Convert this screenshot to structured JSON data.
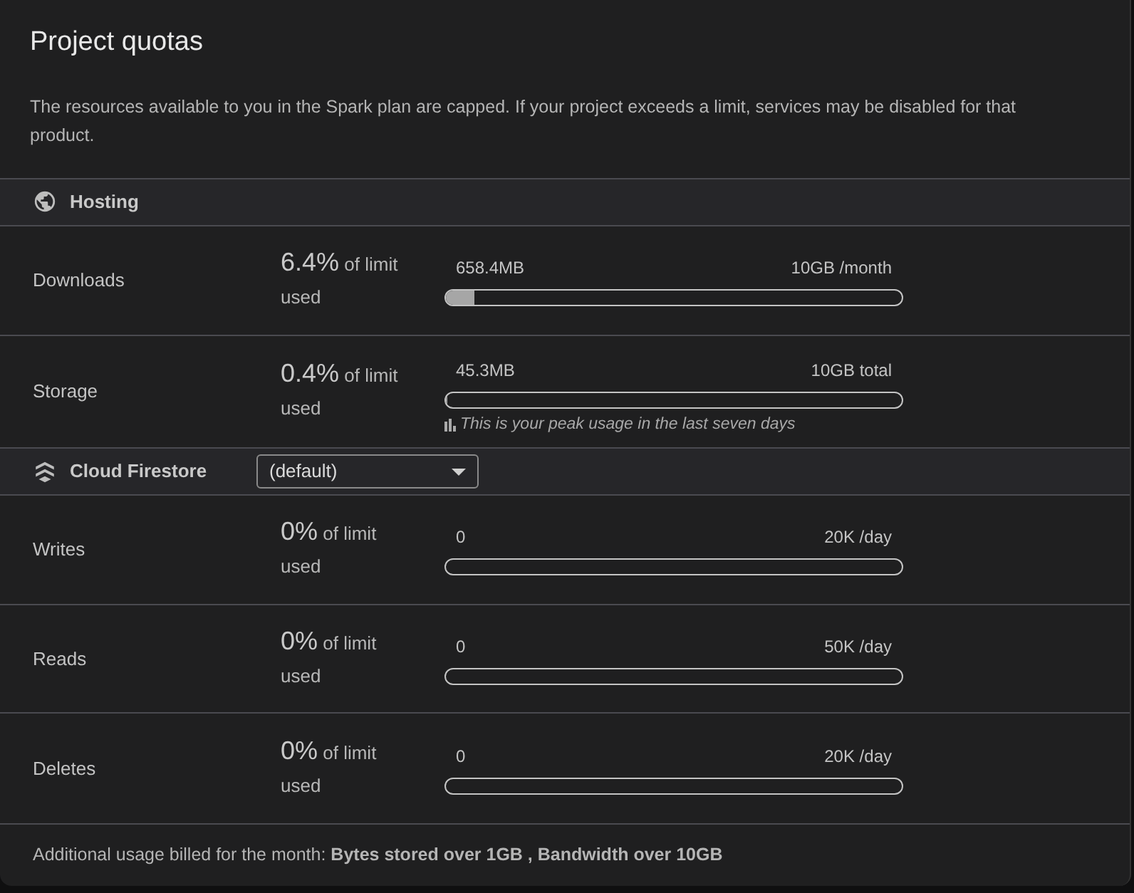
{
  "title": "Project quotas",
  "description": "The resources available to you in the Spark plan are capped. If your project exceeds a limit, services may be disabled for that product.",
  "sections": [
    {
      "title": "Hosting",
      "kind": "hosting",
      "rows": [
        {
          "label": "Downloads",
          "percent": "6.4%",
          "caption": "of limit used",
          "used": "658.4MB",
          "limit": "10GB /month",
          "level": 0.064
        },
        {
          "label": "Storage",
          "percent": "0.4%",
          "caption": "of limit used",
          "used": "45.3MB",
          "limit": "10GB total",
          "level": 0.004,
          "note": "This is your peak usage in the last seven days"
        }
      ]
    },
    {
      "title": "Cloud Firestore",
      "kind": "firestore",
      "selector": {
        "value": "(default)"
      },
      "rows": [
        {
          "label": "Writes",
          "percent": "0%",
          "caption": "of limit used",
          "used": "0",
          "limit": "20K /day",
          "level": 0
        },
        {
          "label": "Reads",
          "percent": "0%",
          "caption": "of limit used",
          "used": "0",
          "limit": "50K /day",
          "level": 0
        },
        {
          "label": "Deletes",
          "percent": "0%",
          "caption": "of limit used",
          "used": "0",
          "limit": "20K /day",
          "level": 0
        }
      ]
    }
  ],
  "footer": "Additional usage billed for the month: **Bytes stored over 1GB , Bandwidth over 10GB**"
}
